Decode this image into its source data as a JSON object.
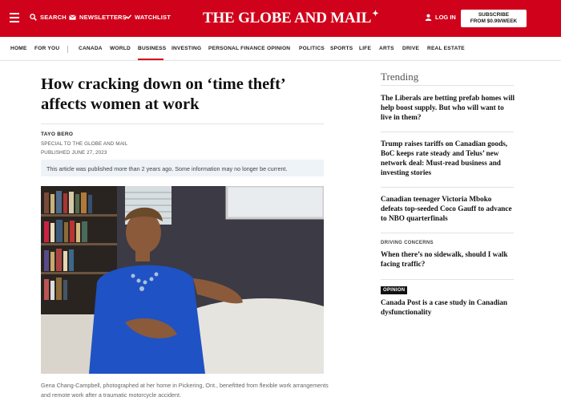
{
  "header": {
    "search_label": "SEARCH",
    "newsletters_label": "NEWSLETTERS",
    "watchlist_label": "WATCHLIST",
    "logo": "THE GLOBE AND MAIL",
    "login_label": "LOG IN",
    "subscribe_line1": "SUBSCRIBE",
    "subscribe_line2": "FROM $0.99/WEEK",
    "brand_color": "#d0021b"
  },
  "nav": {
    "items": [
      "HOME",
      "FOR YOU",
      "CANADA",
      "WORLD",
      "BUSINESS",
      "INVESTING",
      "PERSONAL FINANCE",
      "OPINION",
      "POLITICS",
      "SPORTS",
      "LIFE",
      "ARTS",
      "DRIVE",
      "REAL ESTATE"
    ],
    "active": "BUSINESS"
  },
  "article": {
    "headline": "How cracking down on ‘time theft’ affects women at work",
    "author": "TAYO BERO",
    "affiliation": "SPECIAL TO THE GLOBE AND MAIL",
    "published": "PUBLISHED JUNE 27, 2023",
    "notice": "This article was published more than 2 years ago. Some information may no longer be current.",
    "caption": "Gena Chang-Campbell, photographed at her home in Pickering, Ont., benefitted from flexible work arrangements and remote work after a traumatic motorcycle accident."
  },
  "sidebar": {
    "title": "Trending",
    "stories": [
      {
        "kicker": "",
        "title": "The Liberals are betting prefab homes will help boost supply. But who will want to live in them?"
      },
      {
        "kicker": "",
        "title": "Trump raises tariffs on Canadian goods, BoC keeps rate steady and Telus’ new network deal: Must-read business and investing stories"
      },
      {
        "kicker": "",
        "title": "Canadian teenager Victoria Mboko defeats top-seeded Coco Gauff to advance to NBO quarterfinals"
      },
      {
        "kicker": "DRIVING CONCERNS",
        "title": "When there’s no sidewalk, should I walk facing traffic?"
      },
      {
        "kicker": "OPINION",
        "title": "Canada Post is a case study in Canadian dysfunctionality"
      }
    ]
  }
}
